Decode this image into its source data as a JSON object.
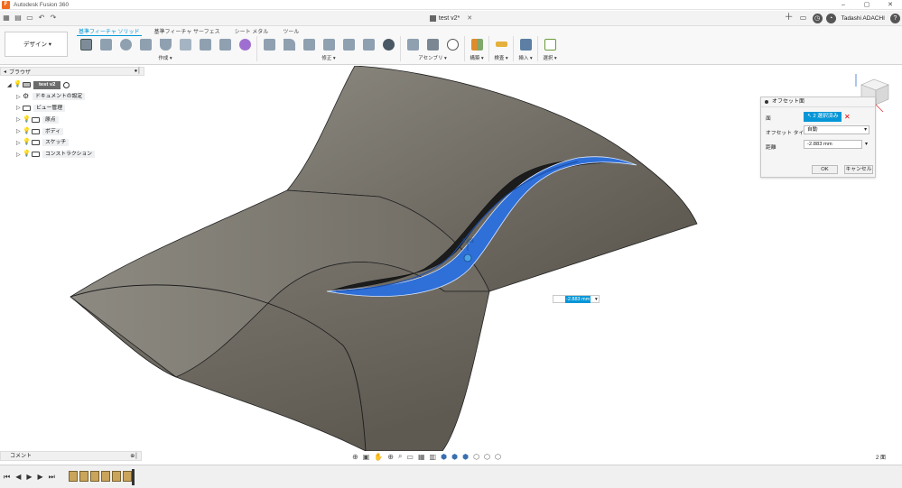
{
  "app": {
    "title": "Autodesk Fusion 360"
  },
  "document": {
    "tab_title": "test v2*"
  },
  "user": {
    "name": "Tadashi ADACHI"
  },
  "workspace": {
    "label": "デザイン ▾"
  },
  "ribbon": {
    "tabs": [
      "基準フィーチャ ソリッド",
      "基準フィーチャ サーフェス",
      "シート メタル",
      "ツール"
    ],
    "groups": [
      "作成 ▾",
      "修正 ▾",
      "アセンブリ ▾",
      "構築 ▾",
      "検査 ▾",
      "挿入 ▾",
      "選択 ▾"
    ]
  },
  "browser": {
    "title": "ブラウザ",
    "root": "test v2",
    "items": [
      "ドキュメントの設定",
      "ビュー管理",
      "原点",
      "ボディ",
      "スケッチ",
      "コンストラクション"
    ]
  },
  "dialog": {
    "title": "オフセット面",
    "face_label": "面",
    "face_value": "2 選択済み",
    "type_label": "オフセット タイプ",
    "type_value": "自動",
    "distance_label": "距離",
    "distance_value": "-2.883 mm",
    "ok": "OK",
    "cancel": "キャンセル"
  },
  "viewport": {
    "dimension_value": "-2.883 mm",
    "dimension_label": "2.88"
  },
  "comment": {
    "title": "コメント"
  },
  "status": {
    "count": "2 面"
  },
  "colors": {
    "accent": "#0696d7",
    "surface": "#6e6a62",
    "selected_face": "#2e6fd8"
  }
}
